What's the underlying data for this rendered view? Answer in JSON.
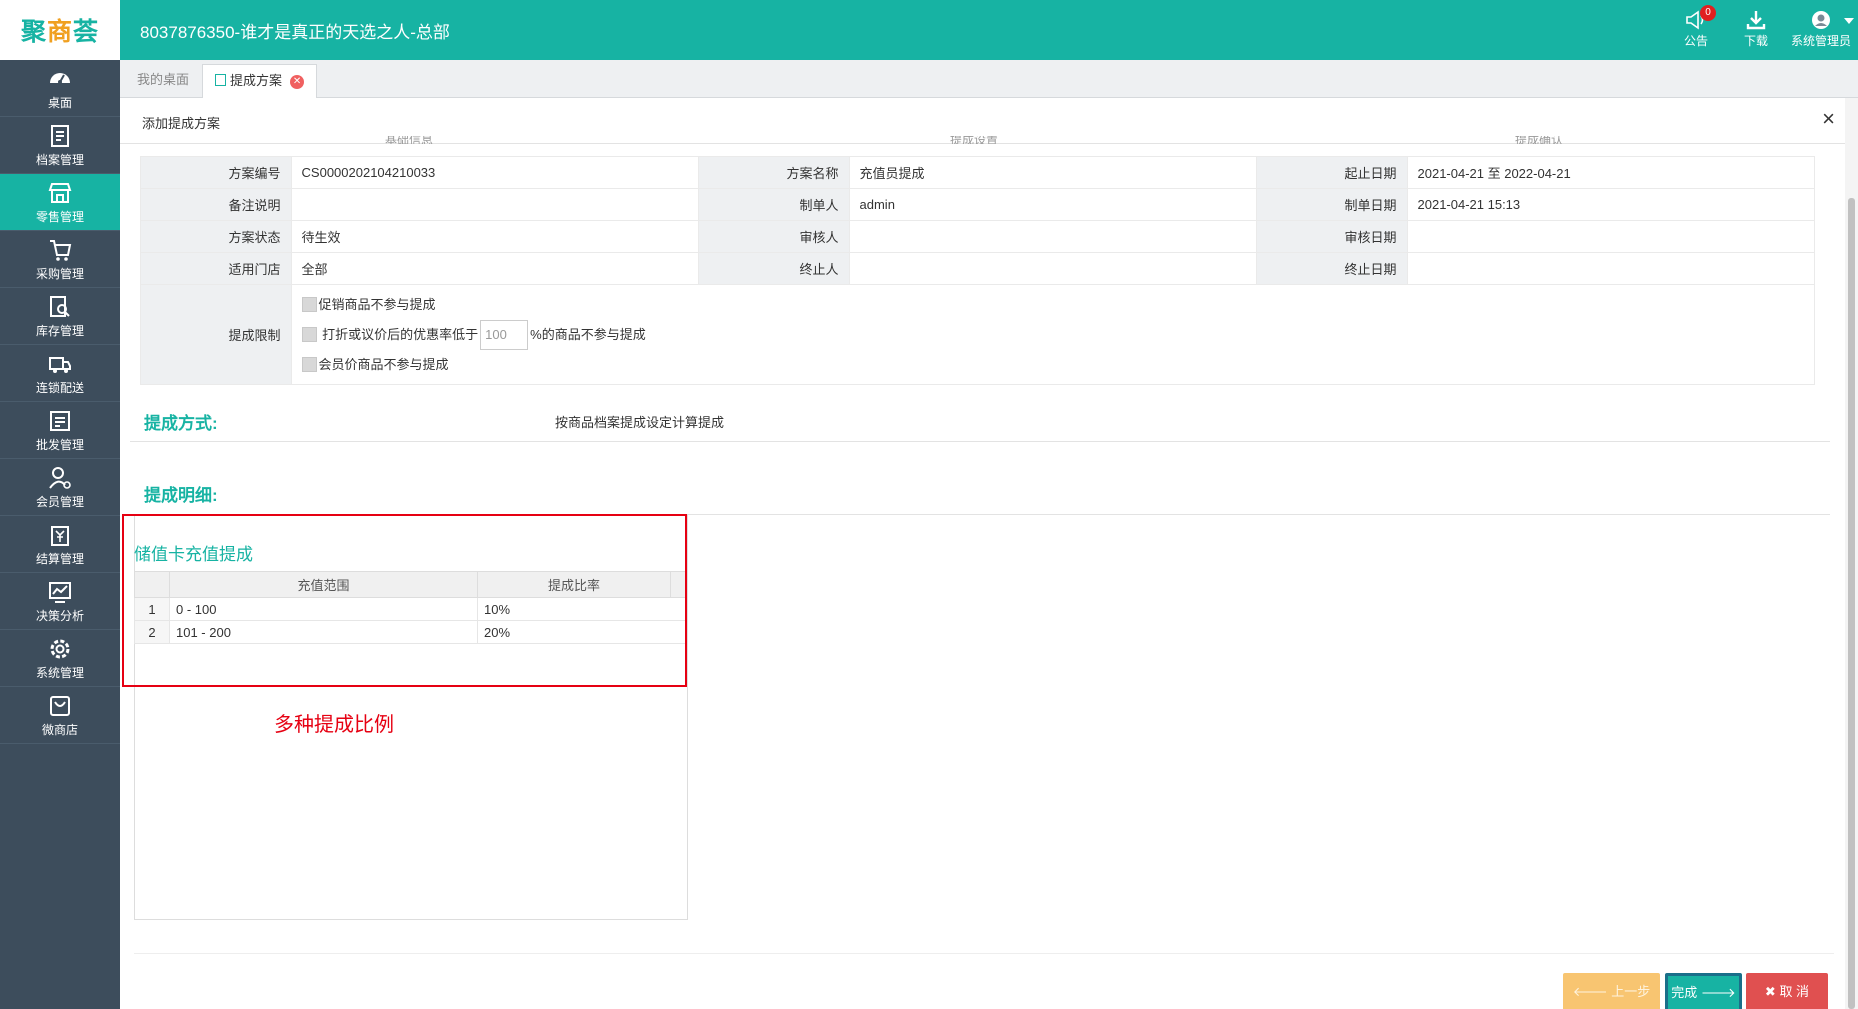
{
  "header": {
    "logo_part1": "聚",
    "logo_part2": "商",
    "logo_part3": "荟",
    "title": "8037876350-谁才是真正的天选之人-总部",
    "announce_label": "公告",
    "announce_badge": "0",
    "download_label": "下载",
    "user_label": "系统管理员"
  },
  "sidebar": {
    "items": [
      {
        "label": "桌面",
        "icon": "dashboard-icon"
      },
      {
        "label": "档案管理",
        "icon": "archive-icon"
      },
      {
        "label": "零售管理",
        "icon": "store-icon"
      },
      {
        "label": "采购管理",
        "icon": "cart-icon"
      },
      {
        "label": "库存管理",
        "icon": "inventory-icon"
      },
      {
        "label": "连锁配送",
        "icon": "truck-icon"
      },
      {
        "label": "批发管理",
        "icon": "wholesale-icon"
      },
      {
        "label": "会员管理",
        "icon": "member-icon"
      },
      {
        "label": "结算管理",
        "icon": "settlement-icon"
      },
      {
        "label": "决策分析",
        "icon": "chart-icon"
      },
      {
        "label": "系统管理",
        "icon": "gear-icon"
      },
      {
        "label": "微商店",
        "icon": "shop-bag-icon"
      }
    ],
    "active_index": 2
  },
  "tabs": {
    "desktop": "我的桌面",
    "current": "提成方案"
  },
  "panel": {
    "title": "添加提成方案",
    "steps": [
      "基础信息",
      "提成设置",
      "提成确认"
    ]
  },
  "info": {
    "plan_no_label": "方案编号",
    "plan_no": "CS0000202104210033",
    "plan_name_label": "方案名称",
    "plan_name": "充值员提成",
    "period_label": "起止日期",
    "period": "2021-04-21 至 2022-04-21",
    "remark_label": "备注说明",
    "remark": "",
    "creator_label": "制单人",
    "creator": "admin",
    "create_date_label": "制单日期",
    "create_date": "2021-04-21 15:13",
    "status_label": "方案状态",
    "status": "待生效",
    "auditor_label": "审核人",
    "auditor": "",
    "audit_date_label": "审核日期",
    "audit_date": "",
    "stores_label": "适用门店",
    "stores": "全部",
    "terminator_label": "终止人",
    "terminator": "",
    "end_date_label": "终止日期",
    "end_date": "",
    "limit_label": "提成限制",
    "limit_opt1": "促销商品不参与提成",
    "limit_opt2_prefix": "打折或议价后的优惠率低于",
    "limit_opt2_value": "100",
    "limit_opt2_suffix": "%的商品不参与提成",
    "limit_opt3": "会员价商品不参与提成"
  },
  "method": {
    "heading": "提成方式:",
    "value": "按商品档案提成设定计算提成"
  },
  "detail": {
    "heading": "提成明细:",
    "table_title": "储值卡充值提成",
    "columns": [
      "充值范围",
      "提成比率"
    ],
    "rows": [
      {
        "idx": "1",
        "range": "0 - 100",
        "rate": "10%"
      },
      {
        "idx": "2",
        "range": "101 - 200",
        "rate": "20%"
      }
    ],
    "annotation": "多种提成比例"
  },
  "buttons": {
    "prev": "上一步",
    "done": "完成",
    "cancel": "取 消"
  },
  "colors": {
    "brand": "#17b3a3",
    "sidebar": "#3d4d5c",
    "annotation_red": "#e60012",
    "prev_btn": "#f8c571",
    "cancel_btn": "#e05050"
  }
}
